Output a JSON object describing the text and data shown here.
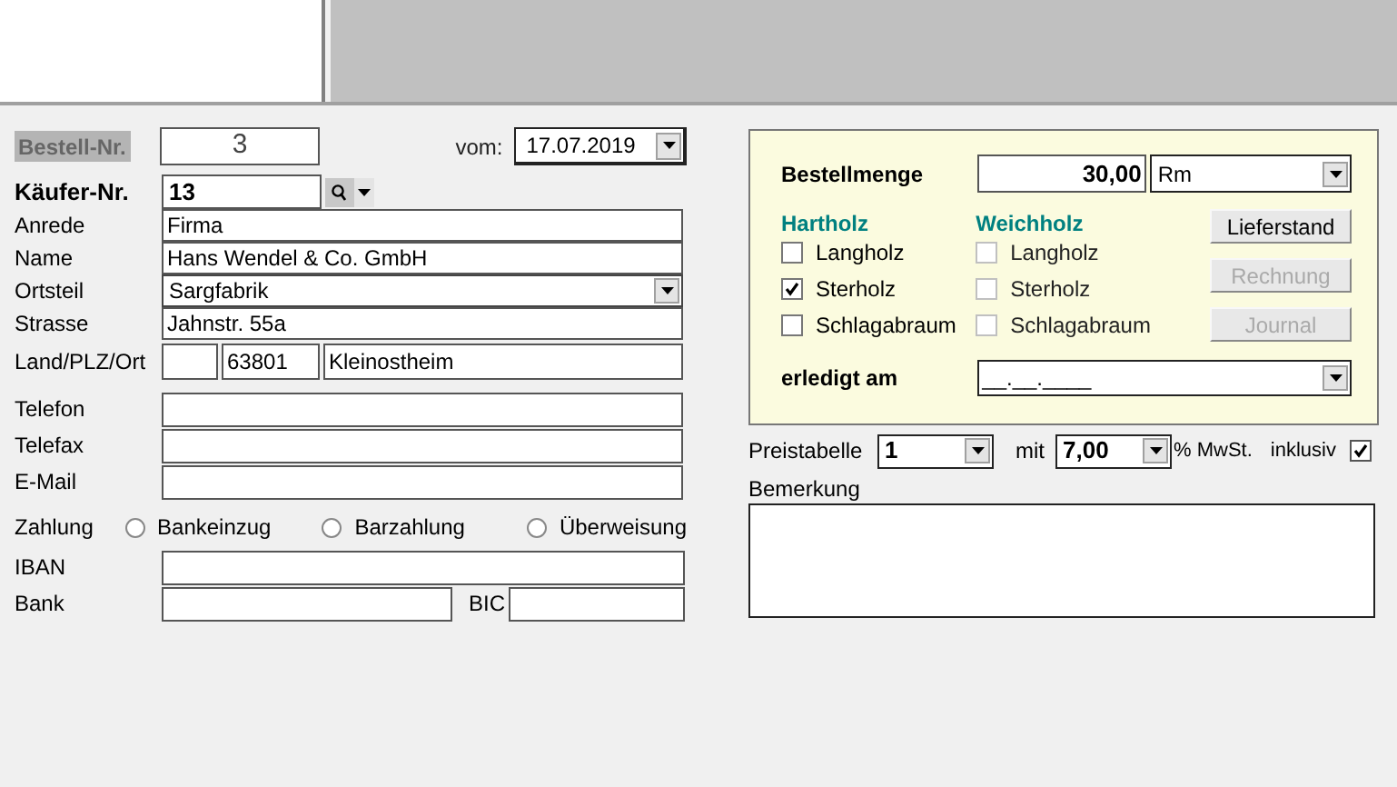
{
  "order": {
    "label": "Bestell-Nr.",
    "number": "3",
    "date_label": "vom:",
    "date": "17.07.2019"
  },
  "buyer": {
    "label": "Käufer-Nr.",
    "number": "13"
  },
  "fields": [
    {
      "label": "Anrede",
      "kind": "text",
      "value": "Firma"
    },
    {
      "label": "Name",
      "kind": "text",
      "value": "Hans Wendel & Co. GmbH"
    },
    {
      "label": "Ortsteil",
      "kind": "dropdown",
      "value": "Sargfabrik"
    },
    {
      "label": "Strasse",
      "kind": "text",
      "value": "Jahnstr. 55a"
    },
    {
      "label": "Land/PLZ/Ort",
      "kind": "address",
      "plz": "63801",
      "ort": "Kleinostheim"
    },
    {
      "label": "Telefon",
      "kind": "text"
    },
    {
      "label": "Telefax",
      "kind": "text"
    },
    {
      "label": "E-Mail",
      "kind": "text"
    }
  ],
  "payment": {
    "label": "Zahlung",
    "options": [
      {
        "label": "Bankeinzug",
        "selected": false
      },
      {
        "label": "Barzahlung",
        "selected": false
      },
      {
        "label": "Überweisung",
        "selected": false
      }
    ]
  },
  "iban": {
    "label": "IBAN"
  },
  "bank": {
    "label": "Bank",
    "bic_label": "BIC"
  },
  "quantity": {
    "label": "Bestellmenge",
    "value": "30,00",
    "unit": "Rm"
  },
  "wood_groups": [
    {
      "title": "Hartholz",
      "items": [
        {
          "label": "Langholz",
          "checked": false,
          "disabled": false
        },
        {
          "label": "Sterholz",
          "checked": true,
          "disabled": false
        },
        {
          "label": "Schlagabraum",
          "checked": false,
          "disabled": false
        }
      ]
    },
    {
      "title": "Weichholz",
      "items": [
        {
          "label": "Langholz",
          "checked": false,
          "disabled": true
        },
        {
          "label": "Sterholz",
          "checked": false,
          "disabled": true
        },
        {
          "label": "Schlagabraum",
          "checked": false,
          "disabled": true
        }
      ]
    }
  ],
  "buttons": [
    {
      "label": "Lieferstand",
      "disabled": false
    },
    {
      "label": "Rechnung",
      "disabled": true
    },
    {
      "label": "Journal",
      "disabled": true
    }
  ],
  "done": {
    "label": "erledigt am",
    "value": "__.__.____"
  },
  "price": {
    "label": "Preistabelle",
    "table": "1",
    "with_label": "mit",
    "vat": "7,00",
    "vat_unit": "% MwSt.",
    "inclusive_label": "inklusiv",
    "inclusive": true
  },
  "remark": {
    "label": "Bemerkung"
  }
}
